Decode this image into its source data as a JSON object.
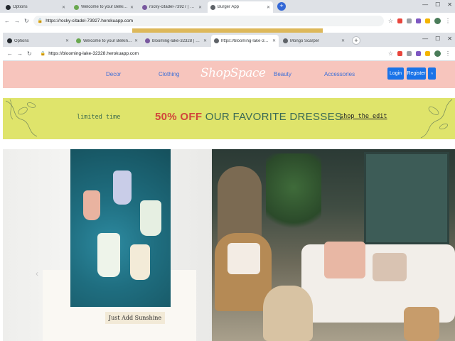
{
  "back_window": {
    "tabs": [
      {
        "title": "Options",
        "favicon_color": "#24292e",
        "active": false
      },
      {
        "title": "Welcome to your Belkin router d",
        "favicon_color": "#6aa84f",
        "active": false
      },
      {
        "title": "rocky-citadel-73927 | Heroku",
        "favicon_color": "#79589f",
        "active": false
      },
      {
        "title": "Burger App",
        "favicon_color": "#5f6368",
        "active": true
      }
    ],
    "url": "https://rocky-citadel-73927.herokuapp.com"
  },
  "front_window": {
    "tabs": [
      {
        "title": "Options",
        "favicon_color": "#24292e",
        "active": false
      },
      {
        "title": "Welcome to your Belkin router d",
        "favicon_color": "#6aa84f",
        "active": false
      },
      {
        "title": "blooming-lake-32328 | Heroku",
        "favicon_color": "#79589f",
        "active": false
      },
      {
        "title": "https://blooming-lake-32328.he",
        "favicon_color": "#5f6368",
        "active": true
      },
      {
        "title": "Mongo Scarper",
        "favicon_color": "#5f6368",
        "active": false
      }
    ],
    "url": "https://blooming-lake-32328.herokuapp.com"
  },
  "site": {
    "nav": {
      "decor": "Decor",
      "clothing": "Clothing",
      "logo": "ShopSpace",
      "beauty": "Beauty",
      "accessories": "Accessories",
      "login": "Login",
      "register": "Register"
    },
    "promo": {
      "limited": "limited time",
      "discount": "50% OFF",
      "headline": "OUR FAVORITE DRESSES",
      "link": "shop the edit"
    },
    "hero": {
      "caption": "Just Add Sunshine",
      "prev_arrow": "‹"
    }
  },
  "colors": {
    "nav_bg": "#f7c5bd",
    "promo_bg": "#dfe46b",
    "accent_blue": "#1a73e8",
    "discount_red": "#d1463b"
  }
}
